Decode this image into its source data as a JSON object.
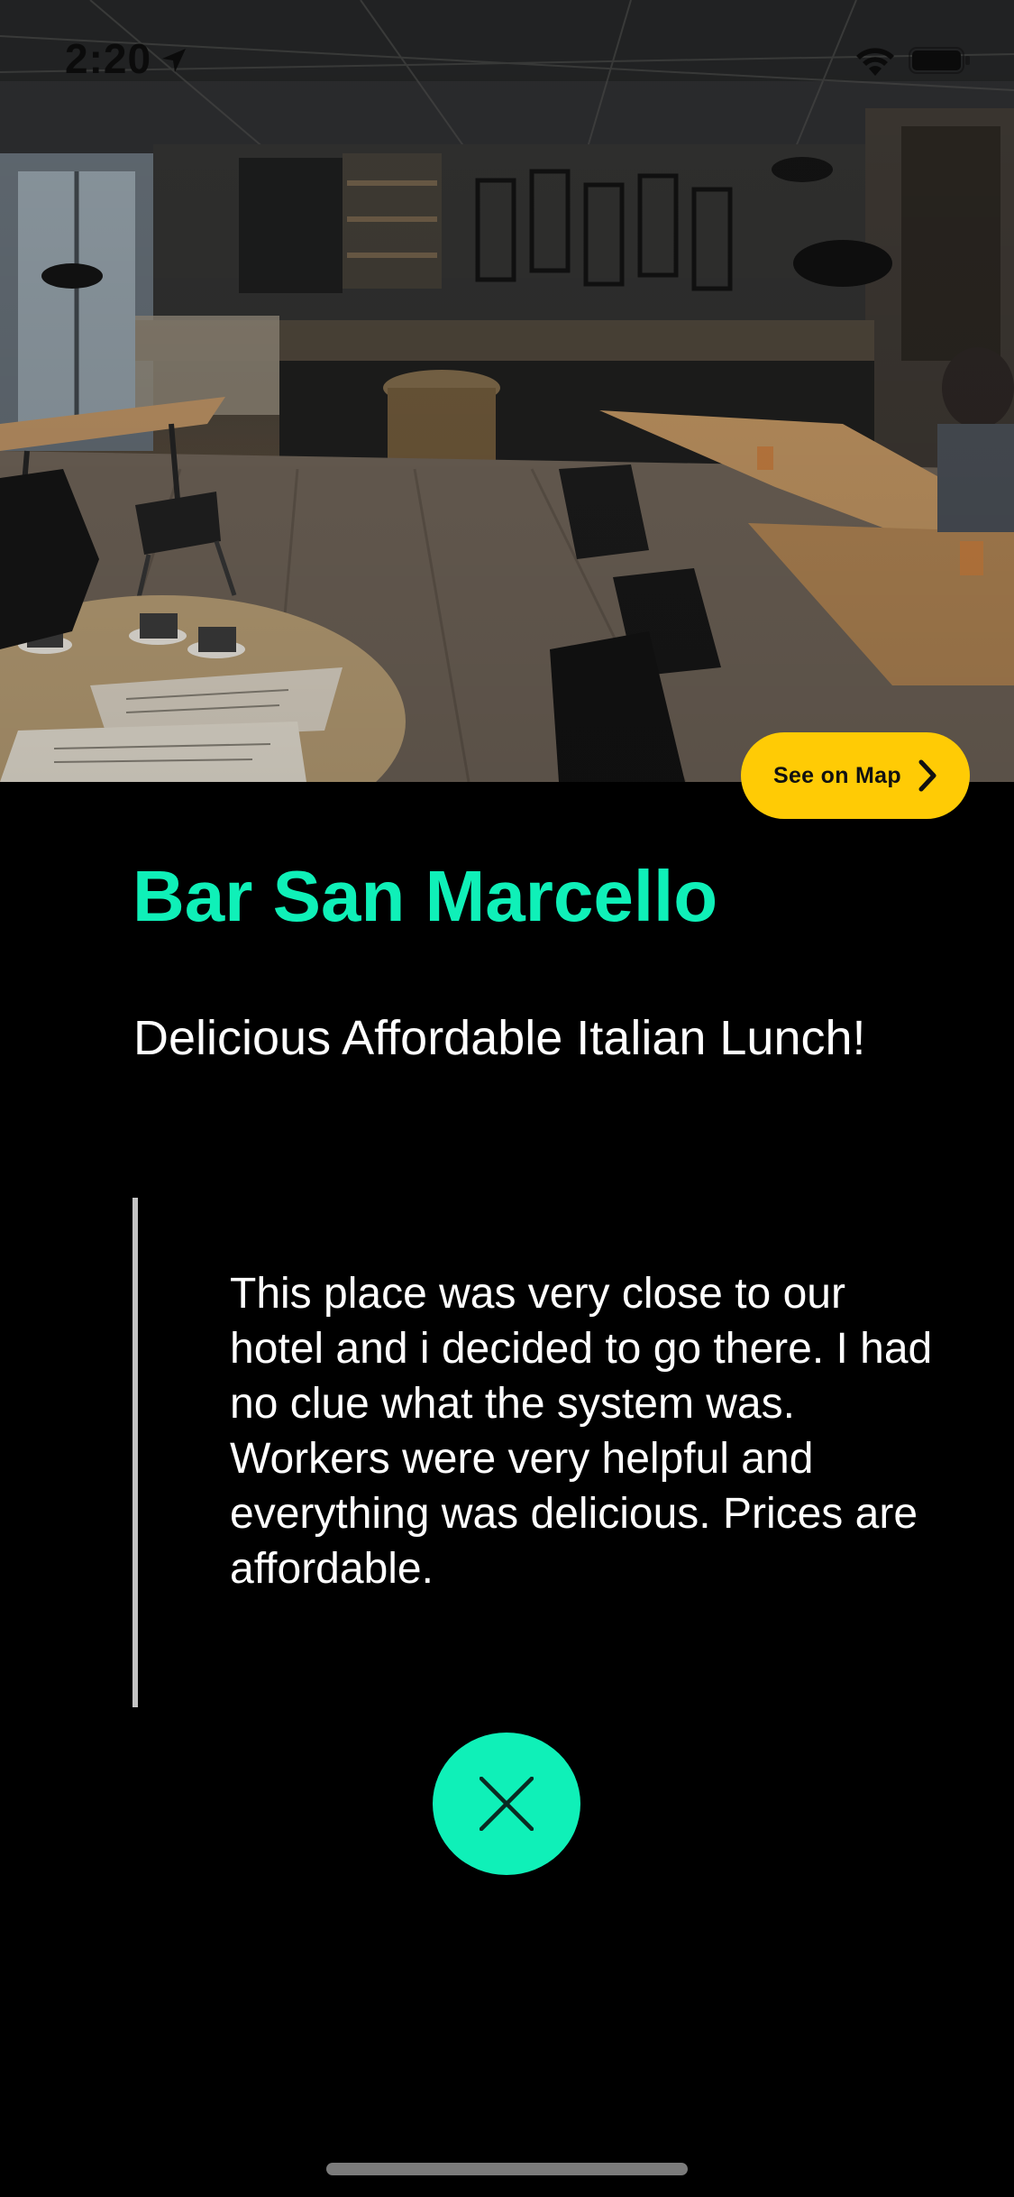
{
  "status_bar": {
    "time": "2:20",
    "location_icon": "location-arrow-icon",
    "wifi_icon": "wifi-icon",
    "battery_icon": "battery-icon"
  },
  "hero": {
    "image": "cafe-interior-photo"
  },
  "map_button": {
    "label": "See on Map",
    "icon": "chevron-right-icon",
    "color": "#ffcb05"
  },
  "venue": {
    "name": "Bar San Marcello",
    "tagline": "Delicious Affordable Italian Lunch!",
    "review": "This place was very close to our hotel and i decided to go there. I had no clue what the system was. Workers were very helpful and everything was delicious. Prices are affordable."
  },
  "close_button": {
    "icon": "close-icon",
    "color": "#0ff0b8"
  },
  "accent_color": "#0ff0b8"
}
